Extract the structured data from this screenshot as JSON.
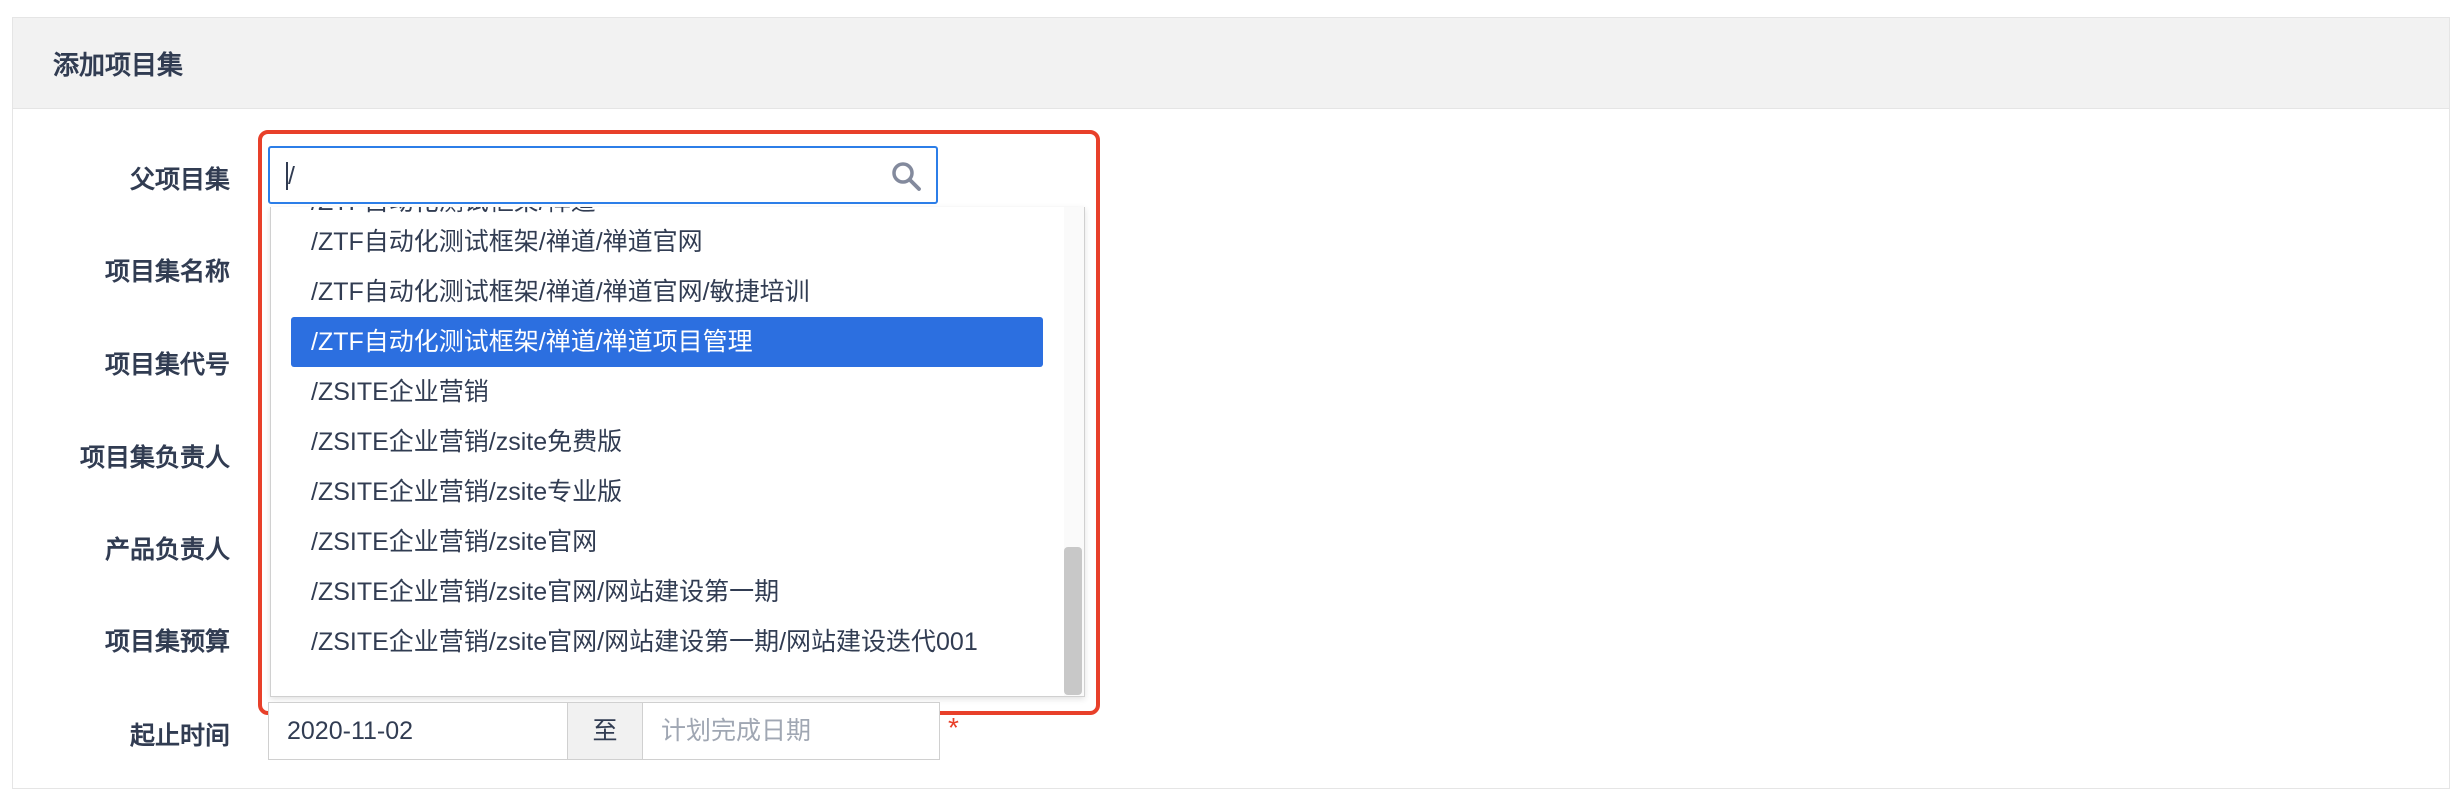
{
  "panel": {
    "title": "添加项目集"
  },
  "form": {
    "labels": {
      "parent": "父项目集",
      "name": "项目集名称",
      "code": "项目集代号",
      "owner": "项目集负责人",
      "product_owner": "产品负责人",
      "budget": "项目集预算",
      "date_range": "起止时间"
    },
    "parent_search": {
      "value": "/",
      "icon": "search-icon"
    },
    "dropdown": {
      "partial_top": "/ZTF自动化测试框架/禅道",
      "options": [
        "/ZTF自动化测试框架/禅道/禅道官网",
        "/ZTF自动化测试框架/禅道/禅道官网/敏捷培训",
        "/ZTF自动化测试框架/禅道/禅道项目管理",
        "/ZSITE企业营销",
        "/ZSITE企业营销/zsite免费版",
        "/ZSITE企业营销/zsite专业版",
        "/ZSITE企业营销/zsite官网",
        "/ZSITE企业营销/zsite官网/网站建设第一期",
        "/ZSITE企业营销/zsite官网/网站建设第一期/网站建设迭代001"
      ],
      "selected_index": 2
    },
    "date": {
      "start": "2020-11-02",
      "separator": "至",
      "end_placeholder": "计划完成日期",
      "required_mark": "*"
    }
  },
  "colors": {
    "accent": "#2c6fe0",
    "highlight_frame": "#e8402a",
    "header_bg": "#f2f2f2"
  }
}
